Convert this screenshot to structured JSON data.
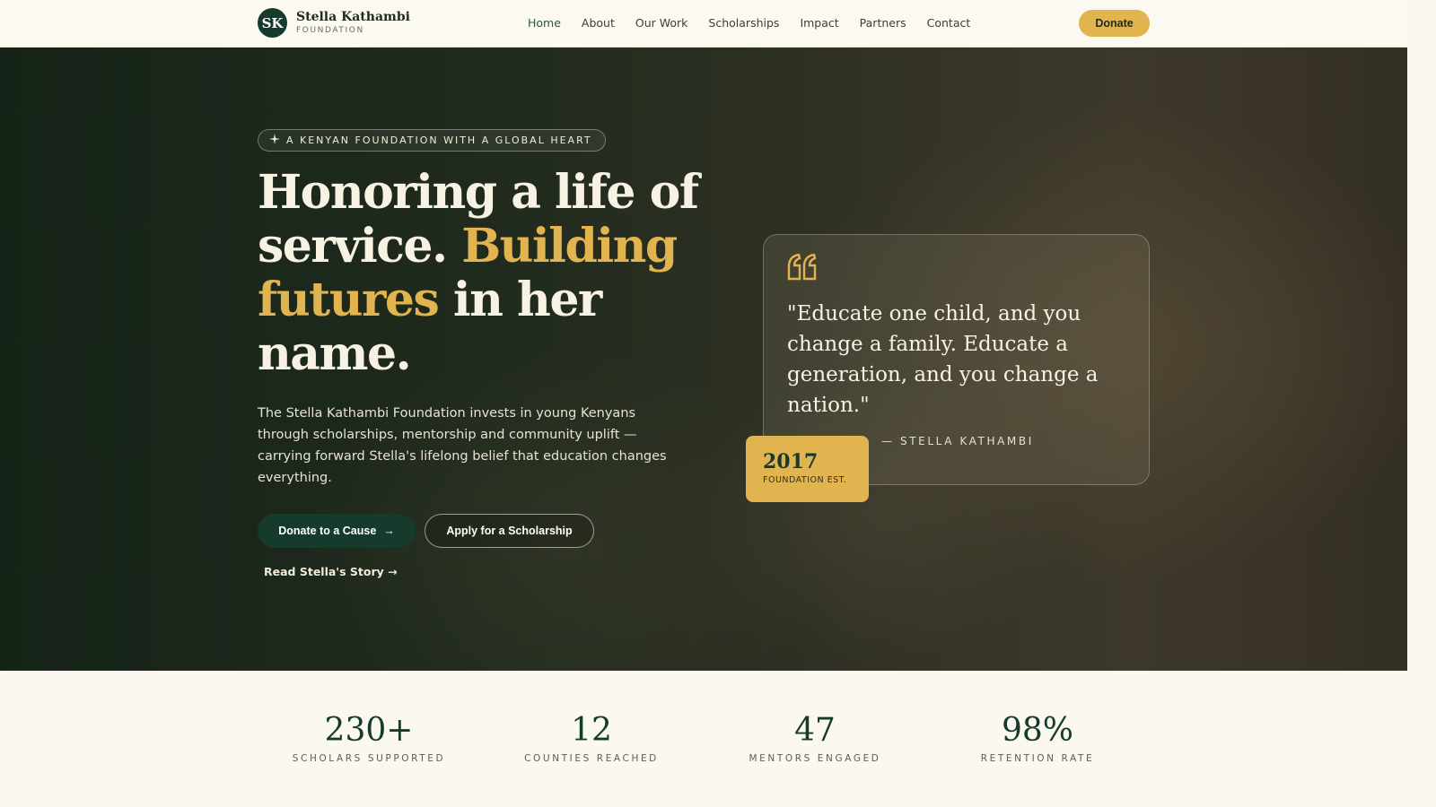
{
  "brand": {
    "initials": "SK",
    "name": "Stella Kathambi",
    "sub": "FOUNDATION"
  },
  "nav": {
    "items": [
      {
        "label": "Home",
        "active": true
      },
      {
        "label": "About"
      },
      {
        "label": "Our Work"
      },
      {
        "label": "Scholarships"
      },
      {
        "label": "Impact"
      },
      {
        "label": "Partners"
      },
      {
        "label": "Contact"
      }
    ],
    "donate_label": "Donate"
  },
  "hero": {
    "eyebrow": "A KENYAN FOUNDATION WITH A GLOBAL HEART",
    "headline_line1": "Honoring a life of service.",
    "headline_gold": "Building futures",
    "headline_rest": " in her name.",
    "lead": "The Stella Kathambi Foundation invests in young Kenyans through scholarships, mentorship and community uplift — carrying forward Stella's lifelong belief that education changes everything.",
    "primary_cta": "Donate to a Cause",
    "primary_cta_arrow": "→",
    "secondary_cta": "Apply for a Scholarship",
    "story_link": "Read Stella's Story →"
  },
  "quote": {
    "text": "\"Educate one child, and you change a family. Educate a generation, and you change a nation.\"",
    "attribution": "— STELLA KATHAMBI"
  },
  "badge": {
    "year": "2017",
    "label": "FOUNDATION EST."
  },
  "stats": [
    {
      "value": "230+",
      "label": "SCHOLARS SUPPORTED"
    },
    {
      "value": "12",
      "label": "COUNTIES REACHED"
    },
    {
      "value": "47",
      "label": "MENTORS ENGAGED"
    },
    {
      "value": "98%",
      "label": "RETENTION RATE"
    }
  ],
  "colors": {
    "brand_green": "#163b2d",
    "accent_gold": "#e1b44f",
    "cream": "#fbf8ef"
  },
  "icons": {
    "eyebrow": "sparkle-icon",
    "quote": "quote-icon",
    "cta": "arrow-right-icon"
  }
}
